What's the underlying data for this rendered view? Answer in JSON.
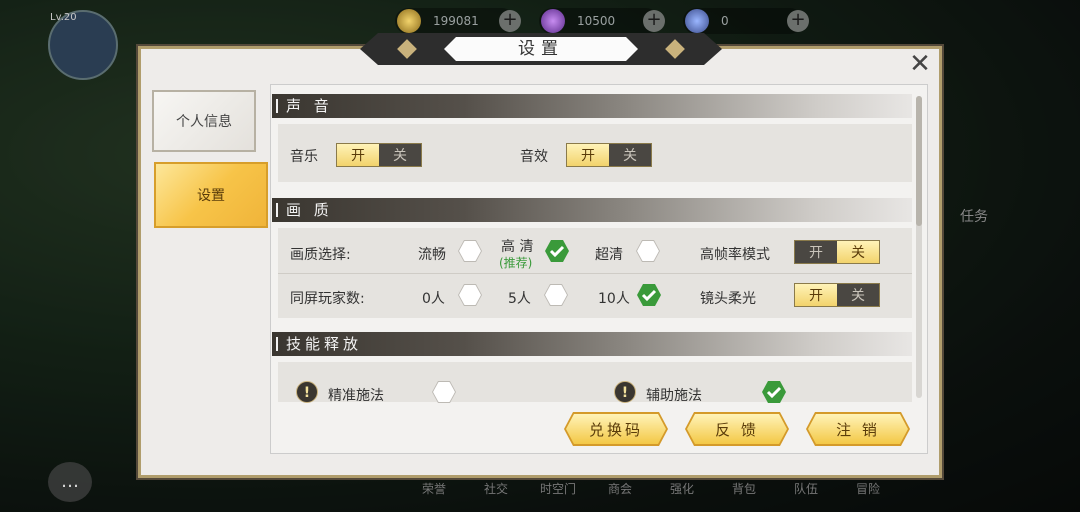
{
  "hud": {
    "level": "Lv.20",
    "resources": [
      {
        "icon": "gold-coin-icon",
        "value": "199081"
      },
      {
        "icon": "purple-gem-icon",
        "value": "10500"
      },
      {
        "icon": "blue-token-icon",
        "value": "0"
      }
    ],
    "bottom_nav": [
      "荣誉",
      "社交",
      "时空门",
      "商会",
      "强化",
      "背包",
      "队伍",
      "冒险"
    ],
    "side_labels": {
      "task": "任务"
    }
  },
  "dialog": {
    "title": "设置",
    "tabs": [
      {
        "label": "个人信息",
        "active": false
      },
      {
        "label": "设置",
        "active": true
      }
    ],
    "sections": {
      "sound": {
        "title": "声 音",
        "music_label": "音乐",
        "sfx_label": "音效",
        "on": "开",
        "off": "关"
      },
      "quality": {
        "title": "画 质",
        "quality_label": "画质选择:",
        "options": [
          {
            "label": "流畅",
            "checked": false
          },
          {
            "label": "高 清",
            "sub": "(推荐)",
            "checked": true
          },
          {
            "label": "超清",
            "checked": false
          }
        ],
        "high_fps_label": "高帧率模式",
        "players_label": "同屏玩家数:",
        "players": [
          {
            "label": "0人",
            "checked": false
          },
          {
            "label": "5人",
            "checked": false
          },
          {
            "label": "10人",
            "checked": true
          }
        ],
        "lens_blur_label": "镜头柔光",
        "on": "开",
        "off": "关"
      },
      "skill": {
        "title": "技能释放",
        "precise_label": "精准施法",
        "assist_label": "辅助施法",
        "precise_checked": false,
        "assist_checked": true
      }
    },
    "buttons": {
      "redeem": "兑换码",
      "feedback": "反 馈",
      "logout": "注 销"
    },
    "colors": {
      "accent_gold": "#f2d36c",
      "check_green": "#3a9a3a",
      "dark_toggle": "#4a4742"
    }
  }
}
